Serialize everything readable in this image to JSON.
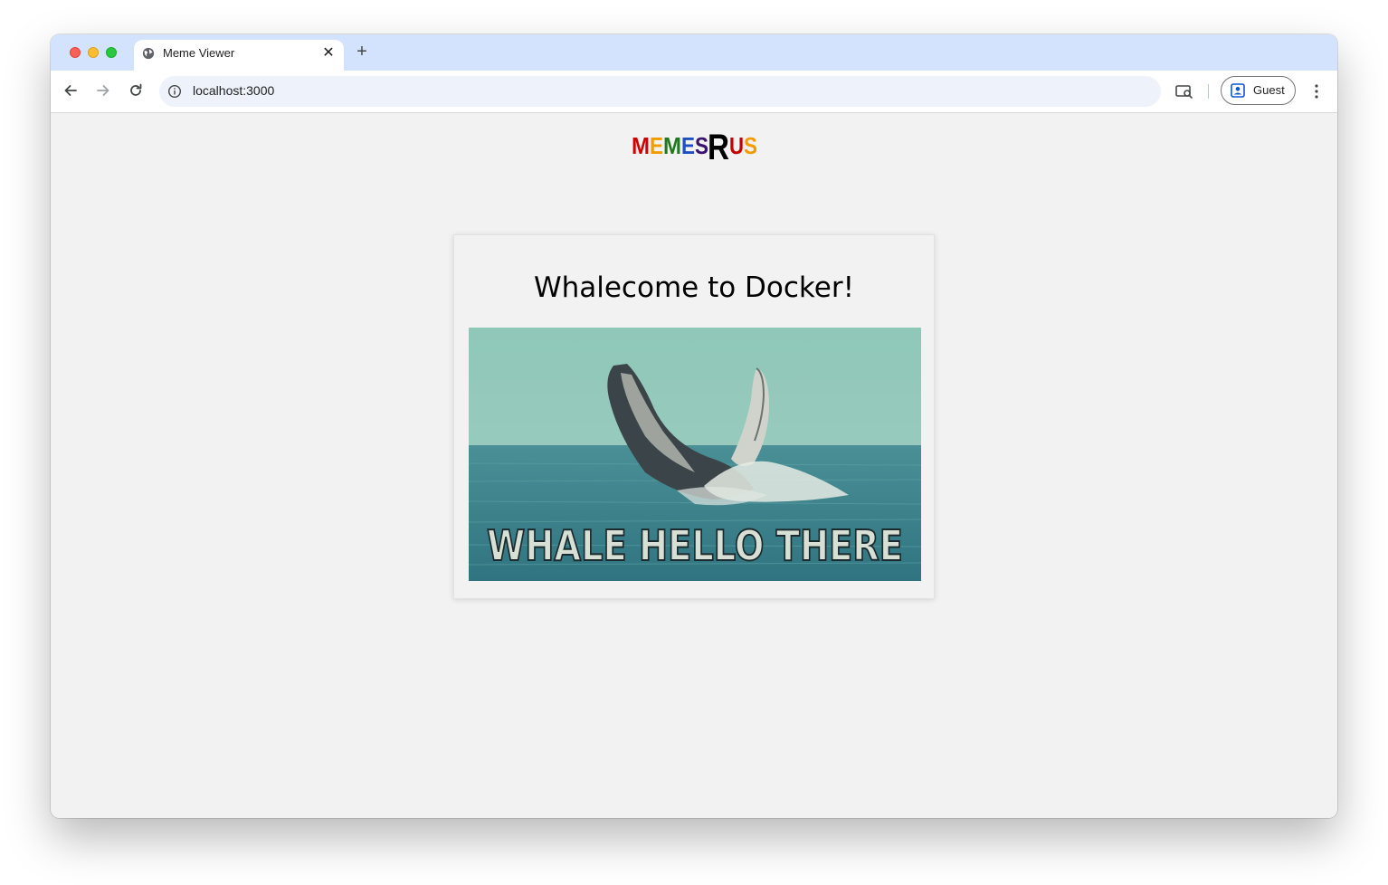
{
  "browser": {
    "tab": {
      "title": "Meme Viewer",
      "close_glyph": "✕",
      "icon": "globe-icon"
    },
    "new_tab_glyph": "+",
    "address_bar": {
      "url": "localhost:3000",
      "icon": "info-icon"
    },
    "profile": {
      "label": "Guest",
      "icon": "person-badge-icon"
    },
    "colors": {
      "tabstrip": "#d3e3fd",
      "omnibox": "#eef2fa",
      "page_background": "#f2f2f2"
    }
  },
  "page": {
    "logo": {
      "letters": [
        {
          "ch": "M",
          "color": "#d30000"
        },
        {
          "ch": "E",
          "color": "#f39c00"
        },
        {
          "ch": "M",
          "color": "#1f7a1f"
        },
        {
          "ch": "E",
          "color": "#1c4fc4"
        },
        {
          "ch": "S",
          "color": "#3a1270"
        },
        {
          "ch": "R",
          "color": "#000000"
        },
        {
          "ch": "U",
          "color": "#c40000"
        },
        {
          "ch": "S",
          "color": "#f39c00"
        }
      ]
    },
    "card": {
      "title": "Whalecome to Docker!",
      "meme": {
        "caption": "WHALE HELLO THERE",
        "colors": {
          "sky": "#8fc7b8",
          "sea": "#3f8a92",
          "caption_fill": "#d8dfd4"
        }
      }
    }
  }
}
